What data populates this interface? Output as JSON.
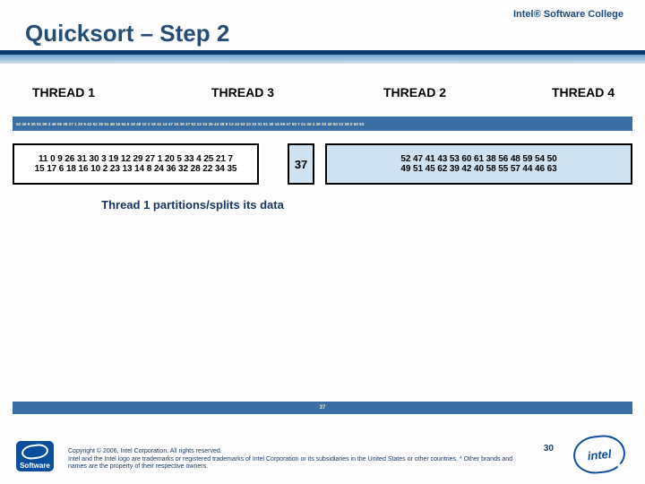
{
  "header": {
    "college": "Intel® Software College",
    "title": "Quicksort – Step 2"
  },
  "threads": {
    "t1": "THREAD 1",
    "t3": "THREAD 3",
    "t2": "THREAD 2",
    "t4": "THREAD 4"
  },
  "longbar_text": "52 46 9 26 51 59 3 49 55 29 27 1 20 5 42 62 25 51 49 15 54 6 18 48 10 2 18 41 14 47 24 36 37 52 22 34 35 44 28 8 13 43 53 23 33 31 61 30 16 59 47 50 7 21 45 4 39 33 40 50 12 38 0 60 63",
  "boxes": {
    "t1_line1": "11 0 9 26 31 30 3 19 12 29 27 1 20 5 33 4 25 21 7",
    "t1_line2": "15 17 6 18 16 10 2 23 13 14 8 24 36 32 28 22 34 35",
    "pivot": "37",
    "t2_line1": "52 47 41 43 53 60 61 38 56 48 59 54 50",
    "t2_line2": "49 51 45 62 39 42 40 58 55 57 44 46 63"
  },
  "caption": "Thread 1 partitions/splits its data",
  "bottombar_center": "37",
  "footer": {
    "copyright_l1": "Copyright © 2006, Intel Corporation. All rights reserved.",
    "copyright_l2": "Intel and the Intel logo are trademarks or registered trademarks of Intel Corporation or its subsidiaries in the United States or other countries. * Other brands and names are the property of their respective owners.",
    "pagenum": "30",
    "logo_left_label": "Software",
    "logo_right_label": "intel"
  }
}
